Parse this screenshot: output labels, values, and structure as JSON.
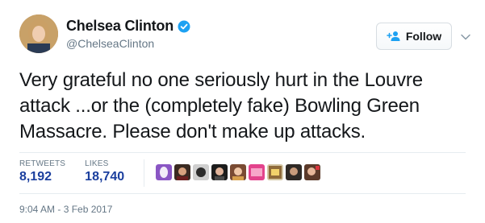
{
  "tweet": {
    "author": {
      "name": "Chelsea Clinton",
      "handle": "@ChelseaClinton",
      "verified_icon": "verified-badge-icon"
    },
    "follow_button": {
      "label": "Follow",
      "icon": "add-person-icon"
    },
    "menu_icon": "chevron-down-icon",
    "text": "Very grateful no one seriously hurt in the Louvre attack ...or the (completely fake) Bowling Green Massacre. Please don't make up attacks.",
    "stats": {
      "retweets": {
        "label": "RETWEETS",
        "value": "8,192"
      },
      "likes": {
        "label": "LIKES",
        "value": "18,740"
      }
    },
    "timestamp": "9:04 AM - 3 Feb 2017"
  },
  "colors": {
    "text": "#14171a",
    "secondary": "#657786",
    "link_blue": "#1b3f9e",
    "verified": "#1da1f2",
    "divider": "#e6ecf0"
  }
}
